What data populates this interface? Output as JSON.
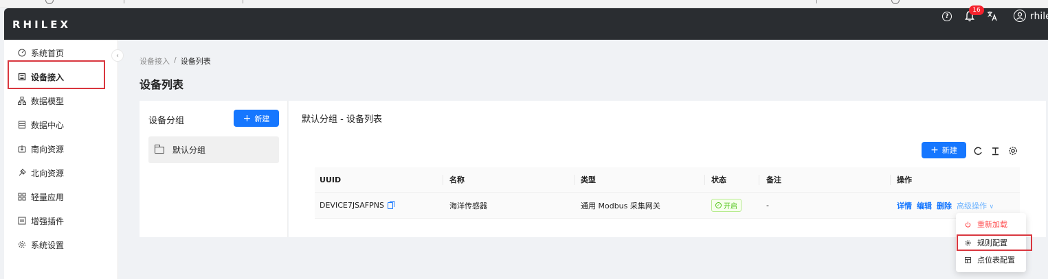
{
  "header": {
    "logo": "RHILEX",
    "notification_count": "16",
    "username": "rhile"
  },
  "sidebar": {
    "items": [
      {
        "label": "系统首页",
        "icon": "dashboard-icon"
      },
      {
        "label": "设备接入",
        "icon": "device-icon",
        "active": true
      },
      {
        "label": "数据模型",
        "icon": "model-icon"
      },
      {
        "label": "数据中心",
        "icon": "datacenter-icon"
      },
      {
        "label": "南向资源",
        "icon": "south-icon"
      },
      {
        "label": "北向资源",
        "icon": "north-icon"
      },
      {
        "label": "轻量应用",
        "icon": "app-icon"
      },
      {
        "label": "增强插件",
        "icon": "plugin-icon"
      },
      {
        "label": "系统设置",
        "icon": "gear-icon"
      }
    ]
  },
  "breadcrumb": {
    "parent": "设备接入",
    "separator": "/",
    "current": "设备列表"
  },
  "page_title": "设备列表",
  "group_panel": {
    "title": "设备分组",
    "new_button": "新建",
    "groups": [
      "默认分组"
    ]
  },
  "list_panel": {
    "title": "默认分组 - 设备列表",
    "new_button": "新建"
  },
  "table": {
    "columns": [
      "UUID",
      "名称",
      "类型",
      "状态",
      "备注",
      "操作"
    ],
    "rows": [
      {
        "uuid": "DEVICE7JSAFPNS",
        "name": "海洋传感器",
        "type": "通用 Modbus 采集网关",
        "status": "开启",
        "note": "-",
        "actions": {
          "detail": "详情",
          "edit": "编辑",
          "delete": "删除",
          "advanced": "高级操作"
        }
      }
    ]
  },
  "dropdown": {
    "items": [
      {
        "label": "重新加载",
        "icon": "power-icon",
        "danger": true
      },
      {
        "label": "规则配置",
        "icon": "gear-icon"
      },
      {
        "label": "点位表配置",
        "icon": "table-icon"
      }
    ]
  },
  "colors": {
    "header_bg": "#2a2d31",
    "primary": "#1677ff",
    "danger": "#ff4d4f",
    "success": "#52c41a",
    "highlight_border": "#d9363e"
  }
}
